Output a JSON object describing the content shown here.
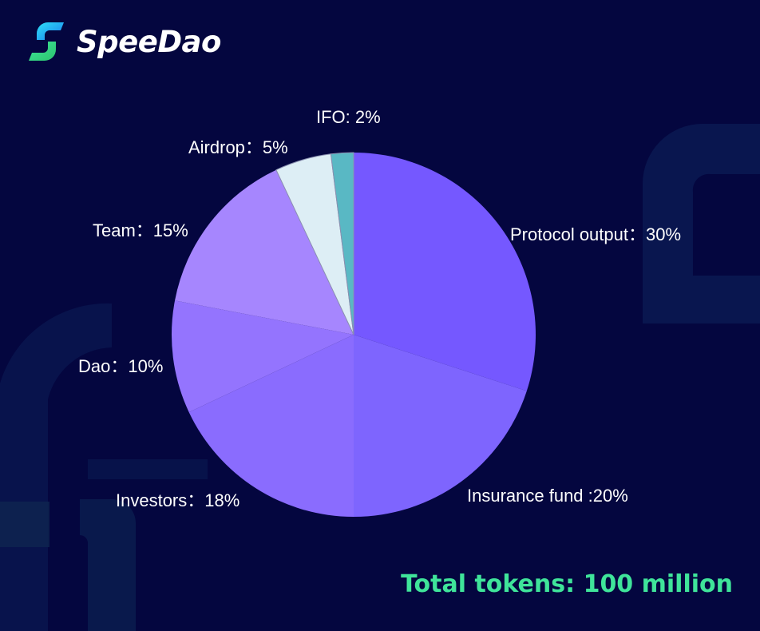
{
  "brand": {
    "name": "SpeeDao"
  },
  "chart_data": {
    "type": "pie",
    "slices": [
      {
        "label": "Protocol output：30%",
        "value": 30,
        "color": "#7558ff"
      },
      {
        "label": "Insurance fund :20%",
        "value": 20,
        "color": "#7e65fe"
      },
      {
        "label": "Investors：18%",
        "value": 18,
        "color": "#8a6cfe"
      },
      {
        "label": "Dao：10%",
        "value": 10,
        "color": "#9474fe"
      },
      {
        "label": "Team：15%",
        "value": 15,
        "color": "#a686fe"
      },
      {
        "label": "Airdrop：5%",
        "value": 5,
        "color": "#ddeef5"
      },
      {
        "label": "IFO: 2%",
        "value": 2,
        "color": "#59b8c4"
      }
    ]
  },
  "footer": {
    "total": "Total tokens: 100 million"
  },
  "colors": {
    "background": "#04063f",
    "accent": "#3fe49a"
  }
}
